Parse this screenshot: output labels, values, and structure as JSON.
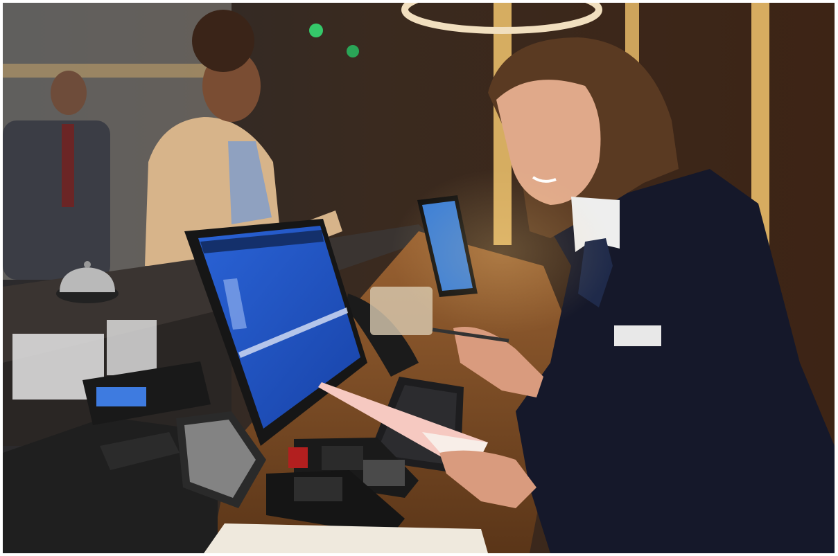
{
  "image": {
    "kind": "photograph",
    "subject": "hotel-reception-desk"
  },
  "palette": {
    "wall_wood": "#3b2416",
    "desk_wood": "#7a4a26",
    "counter_stone": "#3a3431",
    "screen_blue": "#1f56c9",
    "jacket_navy": "#15182a",
    "warm_light": "#f2c46d"
  }
}
